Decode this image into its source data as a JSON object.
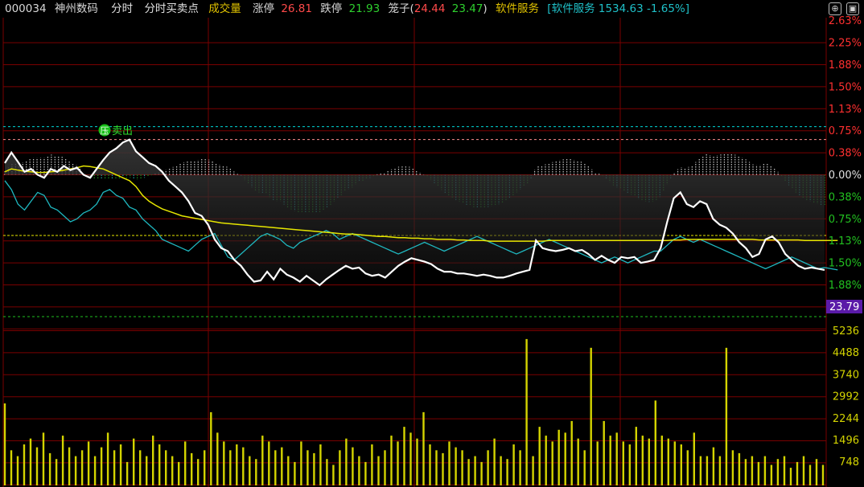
{
  "header": {
    "code": "000034",
    "name": "神州数码",
    "tab_intraday": "分时",
    "tab_signals": "分时买卖点",
    "tab_volume": "成交量",
    "limit_up_label": "涨停",
    "limit_up_value": "26.81",
    "limit_down_label": "跌停",
    "limit_down_value": "21.93",
    "cage_text": "笼子(",
    "cage_high": "24.44",
    "cage_low": "23.47",
    "cage_close": ")",
    "sector_name": "软件服务",
    "sector_index": "[软件服务 1534.63 -1.65%]",
    "icons": [
      "plus-circle-icon",
      "square-toggle-icon"
    ]
  },
  "annotation": {
    "icon_text": "压",
    "signal_text": "卖出"
  },
  "price_axis": {
    "labels_up": [
      "2.63%",
      "2.25%",
      "1.88%",
      "1.50%",
      "1.13%",
      "0.75%",
      "0.38%"
    ],
    "label_zero": "0.00%",
    "labels_down": [
      "0.38%",
      "0.75%",
      "1.13%",
      "1.50%",
      "1.88%"
    ],
    "current_price": "23.79"
  },
  "volume_axis": {
    "labels": [
      "5236",
      "4488",
      "3740",
      "2992",
      "2244",
      "1496",
      "748"
    ]
  },
  "colors": {
    "background": "#000000",
    "grid": "#7a0000",
    "price_line": "#ffffff",
    "avg_line": "#e6e600",
    "sector_line": "#1fb8c0",
    "up": "#ff3030",
    "down": "#22c020",
    "volume": "#d4d400",
    "cyan_dash": "#00d8d8",
    "pink_dash": "#ff9090",
    "green_dash": "#20c020",
    "price_badge": "#5a1aa8"
  },
  "chart_data": {
    "type": "line",
    "price_pct_range": [
      -2.0,
      2.63
    ],
    "price_series": [
      0.2,
      0.38,
      0.22,
      0.05,
      0.1,
      0.0,
      -0.05,
      0.1,
      0.05,
      0.15,
      0.08,
      0.12,
      0.0,
      -0.05,
      0.1,
      0.25,
      0.38,
      0.45,
      0.55,
      0.6,
      0.4,
      0.3,
      0.2,
      0.15,
      0.05,
      -0.1,
      -0.2,
      -0.3,
      -0.45,
      -0.65,
      -0.7,
      -0.85,
      -1.1,
      -1.25,
      -1.3,
      -1.45,
      -1.55,
      -1.7,
      -1.82,
      -1.8,
      -1.65,
      -1.78,
      -1.6,
      -1.7,
      -1.75,
      -1.82,
      -1.72,
      -1.8,
      -1.88,
      -1.78,
      -1.7,
      -1.62,
      -1.55,
      -1.6,
      -1.58,
      -1.68,
      -1.72,
      -1.7,
      -1.75,
      -1.65,
      -1.55,
      -1.48,
      -1.42,
      -1.45,
      -1.48,
      -1.52,
      -1.6,
      -1.65,
      -1.65,
      -1.68,
      -1.68,
      -1.7,
      -1.72,
      -1.7,
      -1.72,
      -1.75,
      -1.75,
      -1.72,
      -1.68,
      -1.65,
      -1.62,
      -1.12,
      -1.25,
      -1.28,
      -1.3,
      -1.28,
      -1.25,
      -1.3,
      -1.28,
      -1.35,
      -1.45,
      -1.38,
      -1.45,
      -1.5,
      -1.4,
      -1.42,
      -1.4,
      -1.5,
      -1.48,
      -1.45,
      -1.25,
      -0.8,
      -0.4,
      -0.3,
      -0.5,
      -0.55,
      -0.45,
      -0.5,
      -0.75,
      -0.85,
      -0.9,
      -1.0,
      -1.15,
      -1.25,
      -1.4,
      -1.35,
      -1.1,
      -1.05,
      -1.15,
      -1.35,
      -1.45,
      -1.55,
      -1.6,
      -1.58,
      -1.6,
      -1.62
    ],
    "avg_series": [
      0.05,
      0.1,
      0.08,
      0.06,
      0.05,
      0.04,
      0.04,
      0.05,
      0.06,
      0.08,
      0.1,
      0.12,
      0.15,
      0.14,
      0.12,
      0.1,
      0.05,
      0.0,
      -0.05,
      -0.1,
      -0.2,
      -0.35,
      -0.45,
      -0.52,
      -0.58,
      -0.62,
      -0.66,
      -0.7,
      -0.72,
      -0.74,
      -0.76,
      -0.78,
      -0.8,
      -0.82,
      -0.83,
      -0.84,
      -0.85,
      -0.86,
      -0.87,
      -0.88,
      -0.89,
      -0.9,
      -0.91,
      -0.92,
      -0.93,
      -0.94,
      -0.95,
      -0.96,
      -0.97,
      -0.98,
      -0.99,
      -1.0,
      -1.01,
      -1.01,
      -1.02,
      -1.03,
      -1.04,
      -1.05,
      -1.05,
      -1.06,
      -1.07,
      -1.07,
      -1.08,
      -1.08,
      -1.09,
      -1.09,
      -1.1,
      -1.1,
      -1.1,
      -1.11,
      -1.11,
      -1.12,
      -1.12,
      -1.12,
      -1.13,
      -1.13,
      -1.13,
      -1.13,
      -1.13,
      -1.13,
      -1.13,
      -1.13,
      -1.13,
      -1.12,
      -1.12,
      -1.12,
      -1.12,
      -1.12,
      -1.12,
      -1.12,
      -1.12,
      -1.12,
      -1.12,
      -1.12,
      -1.12,
      -1.12,
      -1.12,
      -1.12,
      -1.12,
      -1.12,
      -1.12,
      -1.12,
      -1.11,
      -1.11,
      -1.1,
      -1.1,
      -1.1,
      -1.1,
      -1.1,
      -1.1,
      -1.1,
      -1.1,
      -1.1,
      -1.1,
      -1.1,
      -1.11,
      -1.11,
      -1.11,
      -1.11,
      -1.11,
      -1.11,
      -1.11,
      -1.12,
      -1.12,
      -1.12,
      -1.12,
      -1.12,
      -1.12
    ],
    "sector_series": [
      -0.1,
      -0.25,
      -0.5,
      -0.6,
      -0.45,
      -0.3,
      -0.35,
      -0.55,
      -0.6,
      -0.7,
      -0.8,
      -0.75,
      -0.65,
      -0.6,
      -0.5,
      -0.3,
      -0.25,
      -0.35,
      -0.4,
      -0.55,
      -0.6,
      -0.75,
      -0.85,
      -0.95,
      -1.1,
      -1.15,
      -1.2,
      -1.25,
      -1.3,
      -1.2,
      -1.1,
      -1.05,
      -1.0,
      -1.2,
      -1.4,
      -1.45,
      -1.35,
      -1.25,
      -1.15,
      -1.05,
      -1.0,
      -1.05,
      -1.1,
      -1.2,
      -1.25,
      -1.15,
      -1.1,
      -1.05,
      -1.0,
      -0.95,
      -1.0,
      -1.1,
      -1.05,
      -1.0,
      -1.05,
      -1.1,
      -1.15,
      -1.2,
      -1.25,
      -1.3,
      -1.35,
      -1.3,
      -1.25,
      -1.2,
      -1.15,
      -1.2,
      -1.25,
      -1.3,
      -1.25,
      -1.2,
      -1.15,
      -1.1,
      -1.05,
      -1.1,
      -1.15,
      -1.2,
      -1.25,
      -1.3,
      -1.35,
      -1.3,
      -1.25,
      -1.2,
      -1.15,
      -1.1,
      -1.15,
      -1.2,
      -1.25,
      -1.3,
      -1.35,
      -1.4,
      -1.45,
      -1.5,
      -1.45,
      -1.4,
      -1.45,
      -1.5,
      -1.45,
      -1.4,
      -1.35,
      -1.3,
      -1.3,
      -1.2,
      -1.1,
      -1.05,
      -1.1,
      -1.15,
      -1.1,
      -1.15,
      -1.2,
      -1.25,
      -1.3,
      -1.35,
      -1.4,
      -1.45,
      -1.5,
      -1.55,
      -1.6,
      -1.55,
      -1.5,
      -1.45,
      -1.4,
      -1.45,
      -1.5,
      -1.55,
      -1.6,
      -1.58,
      -1.6,
      -1.62
    ],
    "volume_range": [
      0,
      5600
    ],
    "volume": [
      2800,
      1200,
      1000,
      1400,
      1600,
      1300,
      1800,
      1100,
      900,
      1700,
      1300,
      1000,
      1200,
      1500,
      1000,
      1300,
      1800,
      1200,
      1400,
      800,
      1600,
      1200,
      1000,
      1700,
      1400,
      1200,
      1000,
      800,
      1500,
      1100,
      900,
      1200,
      2500,
      1800,
      1500,
      1200,
      1400,
      1300,
      1000,
      900,
      1700,
      1500,
      1200,
      1300,
      1000,
      800,
      1500,
      1200,
      1100,
      1400,
      900,
      700,
      1200,
      1600,
      1300,
      1000,
      800,
      1400,
      1000,
      1200,
      1700,
      1500,
      2000,
      1800,
      1600,
      2500,
      1400,
      1200,
      1100,
      1500,
      1300,
      1200,
      900,
      1000,
      800,
      1200,
      1600,
      1000,
      900,
      1400,
      1200,
      5000,
      1000,
      2000,
      1700,
      1500,
      1900,
      1800,
      2200,
      1600,
      1200,
      4700,
      1500,
      2200,
      1700,
      1800,
      1500,
      1400,
      2000,
      1700,
      1600,
      2900,
      1700,
      1600,
      1500,
      1400,
      1200,
      1800,
      1000,
      1000,
      1300,
      1000,
      4700,
      1200,
      1100,
      900,
      1000,
      800,
      1000,
      700,
      900,
      1000,
      600,
      800,
      1000,
      700,
      900,
      700
    ],
    "volume_note": "",
    "reference_lines": {
      "cyan_dashed_pct": 0.82,
      "pink_dashed_pct": 0.6,
      "green_dashed_pct": -2.0
    }
  }
}
